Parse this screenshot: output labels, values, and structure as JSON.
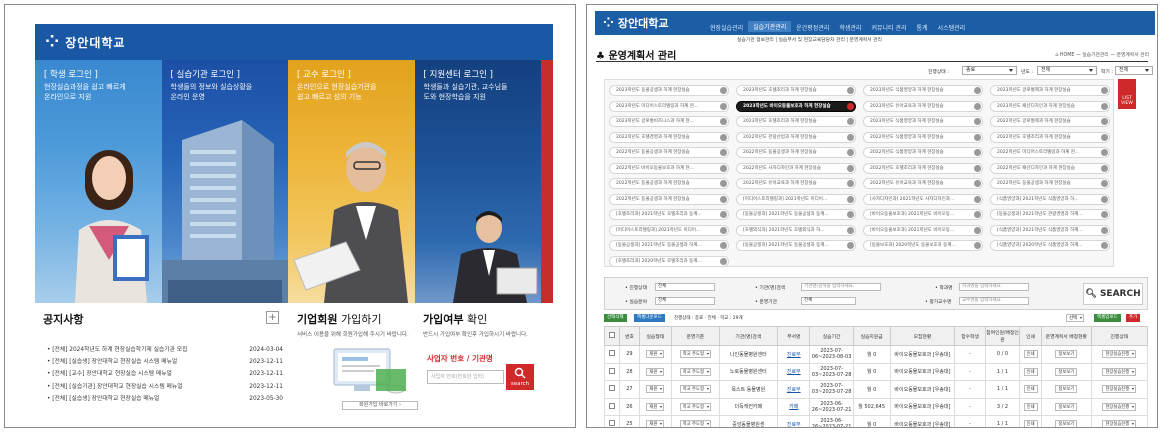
{
  "left": {
    "logo": "장안대학교",
    "columns": [
      {
        "title": "[ 학생 로그인 ]",
        "line1": "현장실습과정을 쉽고 빠르게",
        "line2": "온라인으로 지원"
      },
      {
        "title": "[ 실습기관 로그인 ]",
        "line1": "학생들의 정보와 실습상황을",
        "line2": "온라인 운영"
      },
      {
        "title": "[ 교수 로그인 ]",
        "line1": "온라인으로 현장실습기관을",
        "line2": "쉽고 빠르고 섬의 기능"
      },
      {
        "title": "[ 지원센터 로그인 ]",
        "line1": "학생들과 실습기관, 교수님들",
        "line2": "도와 현장학습을 지원"
      }
    ],
    "notice": {
      "title": "공지사항",
      "items": [
        {
          "text": "[전체] 2024학년도 하계 현장실습학기제 실습기관 모집",
          "date": "2024-03-04"
        },
        {
          "text": "[전체] [실습생] 장안대학교 현장실습 시스템 메뉴얼",
          "date": "2023-12-11"
        },
        {
          "text": "[전체] [교수] 장안대학교 현장실습 시스템 메뉴얼",
          "date": "2023-12-11"
        },
        {
          "text": "[전체] [실습기관] 장안대학교 현장실습 시스템 메뉴얼",
          "date": "2023-12-11"
        },
        {
          "text": "[전체] [실습생] 장안대학교 현장실습 메뉴얼",
          "date": "2023-05-30"
        }
      ]
    },
    "corp": {
      "title_bold": "기업회원",
      "title_rest": " 가입하기",
      "desc": "서비스 이용을 위해 회원가입해 주시기 바랍니다.",
      "button": "회원가입 바로가기"
    },
    "check": {
      "title_bold": "가입여부",
      "title_rest": " 확인",
      "desc": "반드시 가입여부 확인후 가입하시기 바랍니다.",
      "biz_label": "사업자 번호 / 기관명",
      "biz_placeholder": "사업자 번호(번호만 입력)",
      "search": "search"
    }
  },
  "right": {
    "logo": "장안대학교",
    "nav": [
      "현장실습관리",
      "실습기관관리",
      "운간평정관리",
      "학생관리",
      "커뮤니티 관리",
      "통계",
      "시스템관리"
    ],
    "nav_active": 1,
    "subnav": "실습기관 정보관리  |  실습부서 및 현장교육담당자 관리  |  운영계획서 관리",
    "title": "운영계획서 관리",
    "breadcrumb": "HOME — 실습기관관리 — 운영계획서 관리",
    "filters": {
      "status_label": "진행상태 :",
      "status_value": "종료",
      "year_label": "년도 :",
      "year_value": "전체",
      "term_label": "학기 :",
      "term_value": "전체"
    },
    "programs": [
      [
        "2023학년도 동물공생과 하계 현장실습",
        "2023학년도 호텔조리과 하계 현장실습",
        "2023학년도 식품영양과 하계 현장실습",
        "2023학년도 글로벌제과 하계 현장실습"
      ],
      [
        "2023학년도 미디어스토리텔링과 하계 현...",
        "2023학년도 바이오동물보호과 하계 현장실습",
        "2023학년도 유아교육과 하계 현장실습",
        "2023학년도 패션디자인과 하계 현장실습"
      ],
      [
        "2023학년도 글로벌비즈니스과 하계 현...",
        "2023학년도 호텔조리과 하계 현장실습",
        "2023학년도 식품영양과 하계 현장실습",
        "2022학년도 글로벌제과 하계 현장실습"
      ],
      [
        "2022학년도 호텔경영과 하계 현장실습",
        "2022학년도 관광산업과 하계 현장실습",
        "2022학년도 식품영양과 하계 현장실습",
        "2022학년도 호텔조리과 하계 현장실습"
      ],
      [
        "2022학년도 동물공생과 하계 현장실습",
        "2022학년도 동물공생과 하계 현장실습",
        "2022학년도 식품영양과 하계 현장실습",
        "2022학년도 미디어스토리텔링과 하계 현..."
      ],
      [
        "2022학년도 바이오동물보호과 하계 현...",
        "2022학년도 사자디자인과 하계 현장실습",
        "2022학년도 호텔조리과 하계 현장실습",
        "2022학년도 패션디자인과 하계 현장실습"
      ],
      [
        "2022학년도 동물공생과 하계 현장실습",
        "2022학년도 유아교육과 하계 현장실습",
        "2022학년도 유아교육과 하계 현장실습",
        "2022학년도 동물공생과 하계 현장실습"
      ],
      [
        "2022학년도 동물공생과 하계 현장실습",
        "[미디어스토리텔링과] 2021학년도 미디어...",
        "[사자디자인과] 2021학년도 사자디자인과...",
        "[식품영양과] 2021학년도 식품영양과 하..."
      ],
      [
        "[호텔조리과] 2021학년도 호텔조리과 동계...",
        "[동물공생과] 2021학년도 동물공생과 동계...",
        "[바이오동물보호과] 2021학년도 바이오동...",
        "[동물공생과] 2021학년도 관광경영과 하계..."
      ],
      [
        "[미디어스토리텔링과] 2021학년도 미디어...",
        "[호텔외식과] 2021학년도 호텔외식과 하...",
        "[바이오동물보호과] 2021학년도 바이오동...",
        "[식품영양과] 2021학년도 식품영양과 하계..."
      ],
      [
        "[동물공생과] 2021학년도 동물공생과 하계...",
        "[동물공생과] 2021학년도 동물공생과 동계...",
        "[동물보호과] 2020학년도 동물보호과 동계...",
        "[식품영양과] 2020학년도 식품영양과 하계..."
      ],
      [
        "[호텔조리과] 2020학년도 호텔조리과 동계...",
        "",
        "",
        ""
      ]
    ],
    "selected_program": "2023학년도 바이오동물보호과 하계 현장실습",
    "list_tab": "LIST VIEW",
    "search": {
      "status_label": "진행상태",
      "status_value": "전체",
      "org_label": "기관(명)검색",
      "org_placeholder": "기관명(검색을 입력하세요.",
      "dept_label": "학과명",
      "dept_placeholder": "학과명을 입력하세요.",
      "field_label": "실습분야",
      "field_value": "전체",
      "type_label": "운영기관",
      "type_value": "전체",
      "prof_label": "평가교수명",
      "prof_placeholder": "교수명을 입력하세요.",
      "button": "SEARCH"
    },
    "toolbar": {
      "b1": "선택삭제",
      "b2": "엑셀다운로드",
      "count": "진행상태 : 종료 · 전체 · 학교 : 29개",
      "sort": "선택",
      "b3": "엑셀업로드",
      "b4": "추가"
    },
    "headers": [
      "",
      "번호",
      "실습형태",
      "운영기준",
      "기관(명)검색",
      "부서명",
      "실습기간",
      "실습지원금",
      "모집현황",
      "합수학생",
      "참여인원/배정인원",
      "인쇄",
      "운영계획서 배정현황",
      "진행상태"
    ],
    "rows": [
      {
        "no": "29",
        "type": "재원",
        "basis": "학교 주도형",
        "org": "나인동물병원센터",
        "dept": "진료부",
        "period": "2023-07-06~2023-08-03",
        "fund": "월 0",
        "course": "바이오동물보호과 [우송대]",
        "cnt": "0 / 0",
        "state": "현장실습진행"
      },
      {
        "no": "28",
        "type": "재원",
        "basis": "학교 주도형",
        "org": "노로동물병원센터",
        "dept": "진료부",
        "period": "2023-07-03~2023-07-28",
        "fund": "월 0",
        "course": "바이오동물보호과 [우송대]",
        "cnt": "1 / 1",
        "state": "현장실습진행"
      },
      {
        "no": "27",
        "type": "재원",
        "basis": "학교 주도형",
        "org": "목스트 동물병원",
        "dept": "진료부",
        "period": "2023-07-03~2023-07-28",
        "fund": "월 0",
        "course": "바이오동물보호과 [우송대]",
        "cnt": "1 / 1",
        "state": "현장실습진행"
      },
      {
        "no": "26",
        "type": "재원",
        "basis": "학교 주도형",
        "org": "더독캐컨카페",
        "dept": "카페",
        "period": "2023-06-26~2023-07-21",
        "fund": "월 502,645",
        "course": "바이오동물보호과 [우송대]",
        "cnt": "3 / 2",
        "state": "현장실습진행"
      },
      {
        "no": "25",
        "type": "재원",
        "basis": "학교 주도형",
        "org": "중앙동물병원센",
        "dept": "진료부",
        "period": "2023-06-26~2023-07-21",
        "fund": "월 0",
        "course": "바이오동물보호과 [우송대]",
        "cnt": "1 / 1",
        "state": "현장실습진행"
      }
    ],
    "btn_print": "인쇄",
    "btn_assign": "정보보기"
  }
}
